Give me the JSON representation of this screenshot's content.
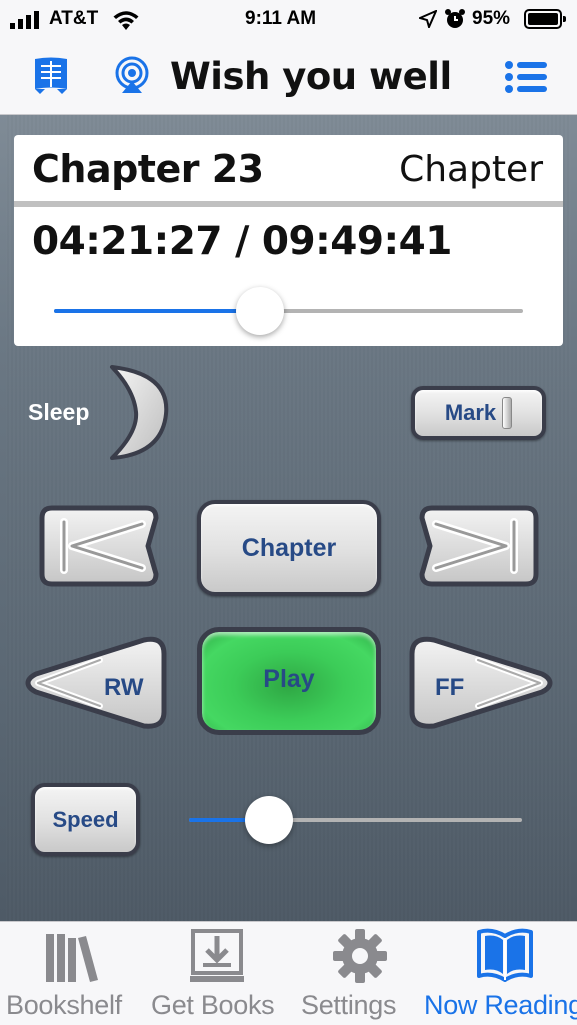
{
  "status_bar": {
    "carrier": "AT&T",
    "time": "9:11 AM",
    "battery_percent": "95%"
  },
  "nav": {
    "title": "Wish you well",
    "left_icons": [
      "book-icon",
      "airplay-icon"
    ],
    "right_icon": "list-icon"
  },
  "now_playing": {
    "chapter_title": "Chapter 23",
    "chapter_button_label": "Chapter",
    "time_text": "04:21:27 / 09:49:41",
    "progress_fraction": 0.44
  },
  "controls": {
    "sleep_label": "Sleep",
    "mark_label": "Mark",
    "chapter_label": "Chapter",
    "rw_label": "RW",
    "play_label": "Play",
    "ff_label": "FF",
    "speed_label": "Speed",
    "speed_fraction": 0.24
  },
  "tab_bar": {
    "items": [
      {
        "label": "Bookshelf",
        "icon": "bookshelf-icon",
        "active": false
      },
      {
        "label": "Get Books",
        "icon": "download-icon",
        "active": false
      },
      {
        "label": "Settings",
        "icon": "gear-icon",
        "active": false
      },
      {
        "label": "Now Reading",
        "icon": "open-book-icon",
        "active": true
      }
    ]
  },
  "colors": {
    "accent": "#1a73e8",
    "button_text": "#274a86",
    "play_green": "#33c24f",
    "inactive_tab": "#8a8a8e"
  }
}
